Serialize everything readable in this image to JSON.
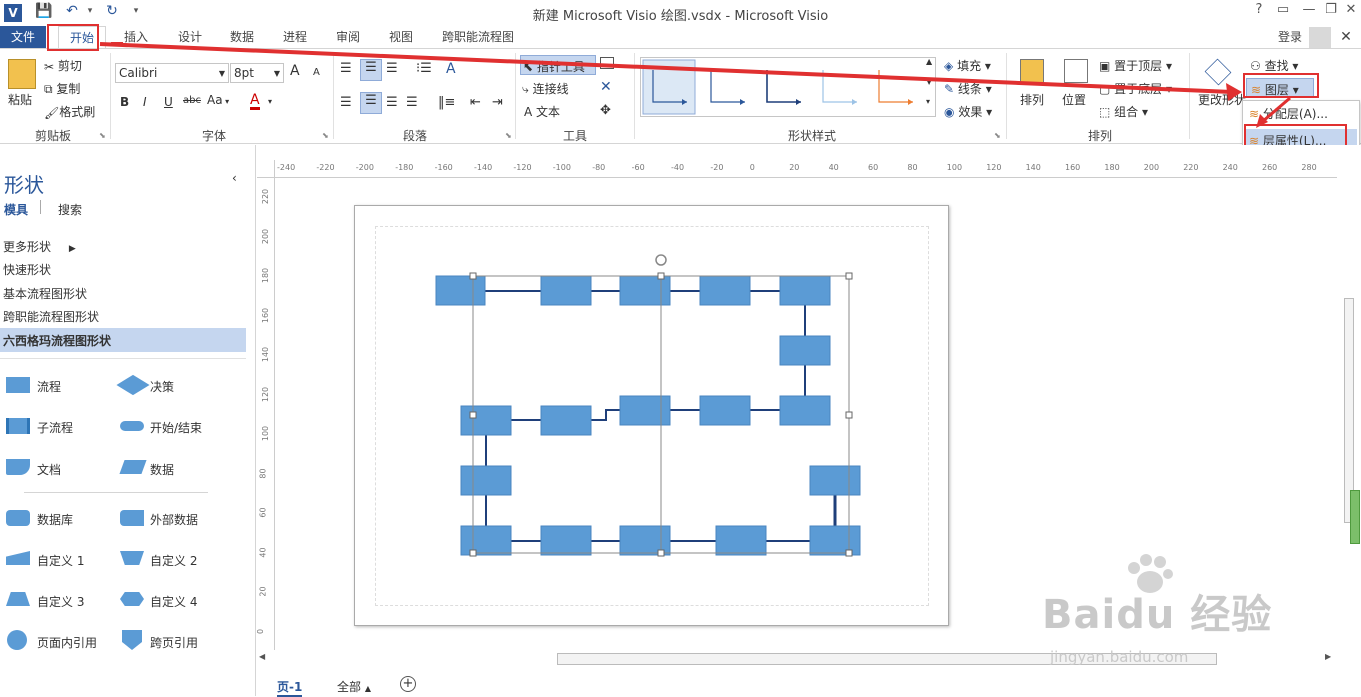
{
  "window": {
    "title": "新建 Microsoft Visio 绘图.vsdx - Microsoft Visio",
    "help": "?",
    "signin": "登录"
  },
  "tabs": [
    "文件",
    "开始",
    "插入",
    "设计",
    "数据",
    "进程",
    "审阅",
    "视图",
    "跨职能流程图"
  ],
  "ribbon": {
    "clipboard": {
      "paste": "粘贴",
      "cut": "剪切",
      "copy": "复制",
      "format_painter": "格式刷",
      "label": "剪贴板"
    },
    "font": {
      "name": "Calibri",
      "size": "8pt",
      "bold": "B",
      "italic": "I",
      "underline": "U",
      "strike": "abc",
      "case": "Aa",
      "color": "A",
      "grow": "A",
      "shrink": "A",
      "label": "字体"
    },
    "paragraph": {
      "label": "段落"
    },
    "tools": {
      "pointer": "指针工具",
      "connector": "连接线",
      "text": "文本",
      "label": "工具"
    },
    "shape_styles": {
      "fill": "填充",
      "line": "线条",
      "effects": "效果",
      "label": "形状样式"
    },
    "arrange": {
      "arrange": "排列",
      "position": "位置",
      "bring_front": "置于顶层",
      "send_back": "置于底层",
      "group": "组合",
      "label": "排列"
    },
    "editing": {
      "change_shape": "更改形状",
      "find": "查找",
      "layers": "图层"
    }
  },
  "layers_menu": {
    "assign": "分配层(A)...",
    "properties": "层属性(L)..."
  },
  "shapes_pane": {
    "title": "形状",
    "tab_stencils": "模具",
    "tab_search": "搜索",
    "items": [
      "更多形状",
      "快速形状",
      "基本流程图形状",
      "跨职能流程图形状",
      "六西格玛流程图形状"
    ],
    "stencils": [
      [
        "流程",
        "决策"
      ],
      [
        "子流程",
        "开始/结束"
      ],
      [
        "文档",
        "数据"
      ],
      [
        "数据库",
        "外部数据"
      ],
      [
        "自定义 1",
        "自定义 2"
      ],
      [
        "自定义 3",
        "自定义 4"
      ],
      [
        "页面内引用",
        "跨页引用"
      ]
    ]
  },
  "ruler": {
    "h": [
      "-240",
      "-220",
      "-200",
      "-180",
      "-160",
      "-140",
      "-120",
      "-100",
      "-80",
      "-60",
      "-40",
      "-20",
      "0",
      "20",
      "40",
      "60",
      "80",
      "100",
      "120",
      "140",
      "160",
      "180",
      "200",
      "220",
      "240",
      "260",
      "280"
    ],
    "v": [
      "220",
      "200",
      "180",
      "160",
      "140",
      "120",
      "100",
      "80",
      "60",
      "40",
      "20",
      "0"
    ]
  },
  "status": {
    "page": "页-1",
    "all": "全部"
  },
  "watermark": {
    "brand": "Baidu 经验",
    "url": "jingyan.baidu.com"
  },
  "colors": {
    "accent": "#2b579a",
    "shape": "#5b9bd5",
    "highlight": "#e03030",
    "connector": "#1f3f7a"
  }
}
